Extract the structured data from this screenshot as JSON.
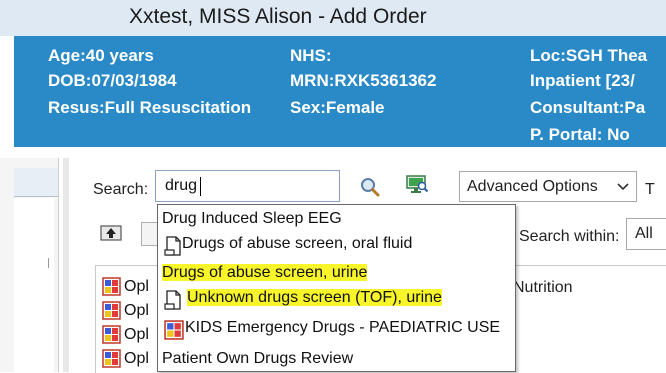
{
  "window": {
    "title": "Xxtest, MISS Alison - Add Order"
  },
  "patient": {
    "age": "Age:40 years",
    "dob": "DOB:07/03/1984",
    "resus": "Resus:Full Resuscitation",
    "nhs": "NHS:",
    "mrn": "MRN:RXK5361362",
    "sex": "Sex:Female",
    "loc": "Loc:SGH Thea",
    "inpatient": "Inpatient [23/",
    "consultant": "Consultant:Pa",
    "portal": "P. Portal: No"
  },
  "search": {
    "label": "Search:",
    "value": "drug",
    "search_icon": "magnifier-icon",
    "browse_icon": "monitor-search-icon"
  },
  "advanced_options": {
    "label": "Advanced Options",
    "icon": "chevron-down-icon"
  },
  "truncated_label": "T",
  "search_within": {
    "label": "Search within:",
    "value": "All"
  },
  "results": {
    "rows": [
      {
        "text": "Opl",
        "icon": "order-set-icon"
      },
      {
        "text": "Opl",
        "icon": "order-set-icon"
      },
      {
        "text": "Opl",
        "icon": "order-set-icon"
      },
      {
        "text": "Opl",
        "icon": "order-set-icon"
      }
    ],
    "column_text": "Nutrition"
  },
  "dropdown": {
    "items": [
      {
        "text": "Drug Induced Sleep EEG",
        "icon": "",
        "highlight": false
      },
      {
        "text": "Drugs of abuse screen, oral fluid",
        "icon": "document-icon",
        "highlight": false
      },
      {
        "text": "Drugs of abuse screen, urine",
        "icon": "",
        "highlight": true
      },
      {
        "text": "Unknown drugs screen (TOF), urine",
        "icon": "document-icon",
        "highlight": true
      },
      {
        "text": "KIDS Emergency Drugs - PAEDIATRIC USE",
        "icon": "order-set-icon",
        "highlight": false
      },
      {
        "text": "Patient Own Drugs Review",
        "icon": "",
        "highlight": false
      }
    ]
  },
  "colors": {
    "banner": "#2a8ac7",
    "highlight": "#f8f52a",
    "titlebar": "#dfe9f4"
  }
}
